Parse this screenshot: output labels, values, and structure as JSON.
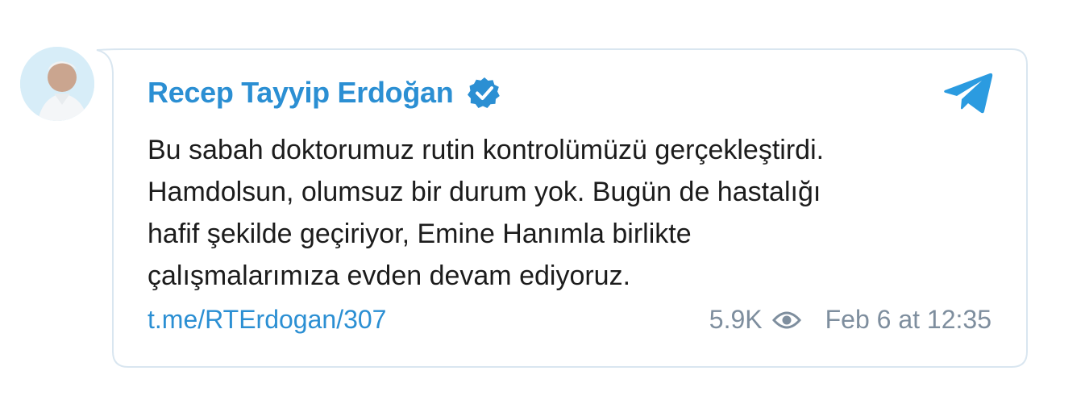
{
  "post": {
    "author": "Recep Tayyip Erdoğan",
    "verified_icon": "verified-badge-icon",
    "channel_icon": "telegram-icon",
    "lines": [
      "Bu sabah doktorumuz rutin kontrolümüzü gerçekleştirdi.",
      "Hamdolsun, olumsuz bir durum yok. Bugün de hastalığı",
      "hafif şekilde geçiriyor, Emine Hanımla birlikte",
      "çalışmalarımıza evden devam ediyoruz."
    ],
    "link": "t.me/RTErdogan/307",
    "views": "5.9K",
    "views_icon": "eye-icon",
    "timestamp": "Feb 6 at 12:35"
  },
  "colors": {
    "accent": "#2b8fd3",
    "meta": "#7e8e9e",
    "text": "#1c1c1c",
    "border": "#d9e6f0"
  }
}
